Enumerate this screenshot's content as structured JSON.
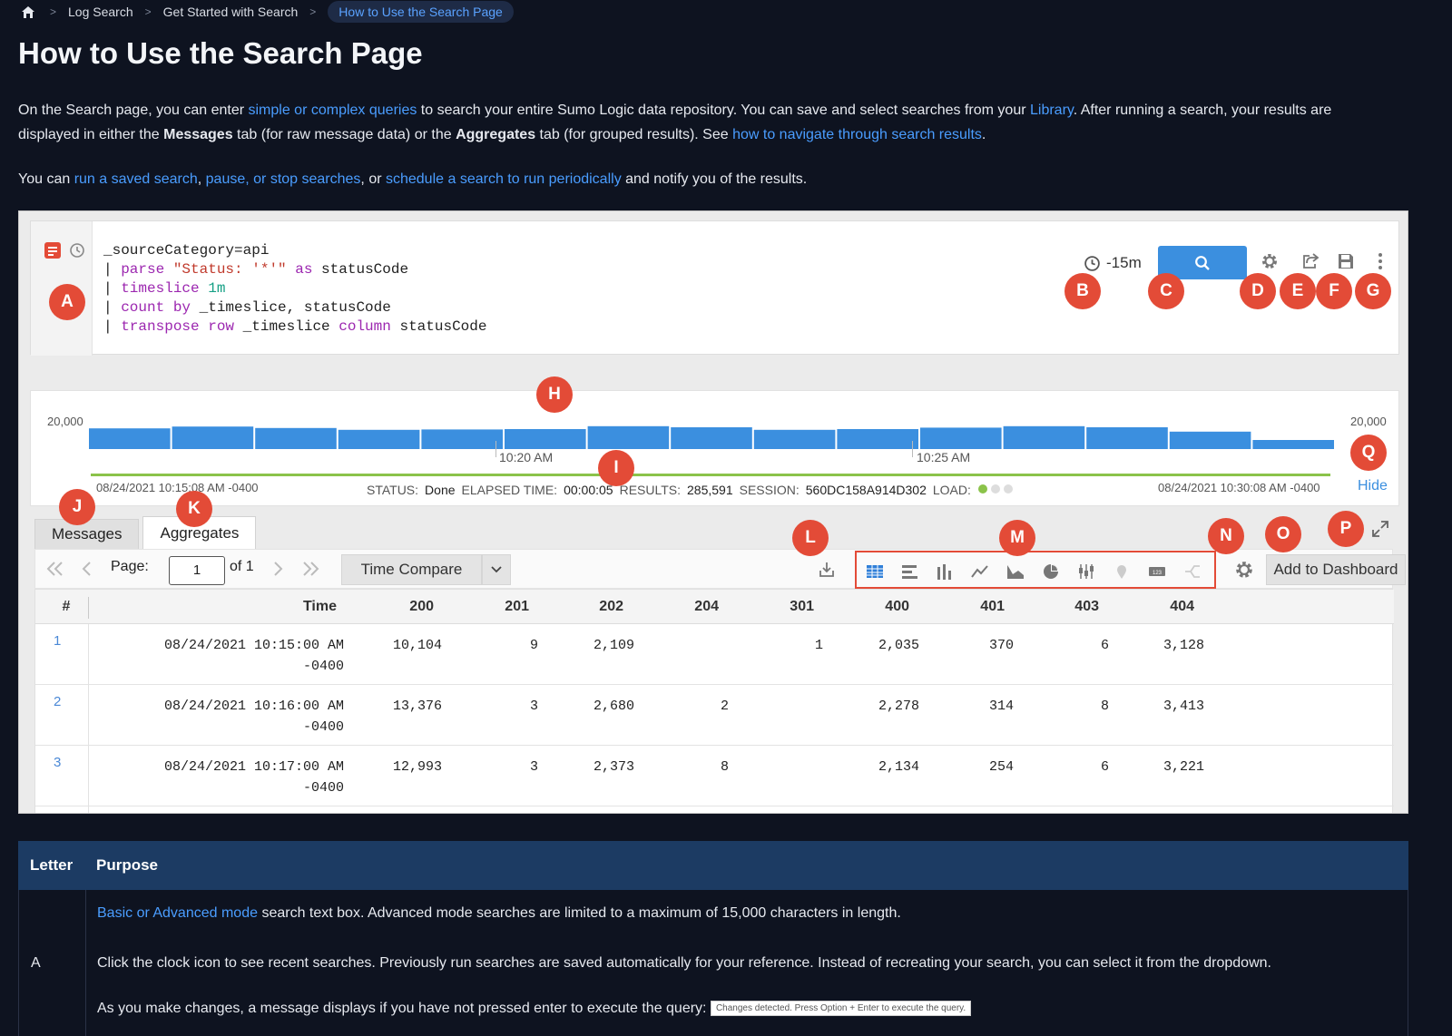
{
  "breadcrumb": {
    "items": [
      "Log Search",
      "Get Started with Search"
    ],
    "current": "How to Use the Search Page"
  },
  "title": "How to Use the Search Page",
  "intro": {
    "p1": {
      "t1": "On the Search page, you can enter ",
      "l1": "simple or complex queries",
      "t2": " to search your entire Sumo Logic data repository. You can save and select searches from your ",
      "l2": "Library",
      "t3": ". After running a search, your results are displayed in either the ",
      "b1": "Messages",
      "t4": " tab (for raw message data) or the ",
      "b2": "Aggregates",
      "t5": " tab (for grouped results). See ",
      "l3": "how to navigate through search results",
      "t6": "."
    },
    "p2": {
      "t1": "You can ",
      "l1": "run a saved search",
      "t2": ", ",
      "l2": "pause, or stop searches",
      "t3": ", or ",
      "l3": "schedule a search to run periodically",
      "t4": " and notify you of the results."
    }
  },
  "screenshot": {
    "query": {
      "l1": "_sourceCategory=api",
      "l2a": "| ",
      "l2b": "parse",
      "l2c": " \"Status: '*'\"",
      "l2d": " as",
      "l2e": " statusCode",
      "l3a": "| ",
      "l3b": "timeslice",
      "l3c": " 1m",
      "l4a": "| ",
      "l4b": "count by",
      "l4c": " _timeslice, statusCode",
      "l5a": "| ",
      "l5b": "transpose row",
      "l5c": " _timeslice ",
      "l5d": "column",
      "l5e": " statusCode"
    },
    "time_range": "-15m",
    "histogram": {
      "y_label_left": "20,000",
      "y_label_right": "20,000",
      "x_ticks": [
        "10:20 AM",
        "10:25 AM"
      ],
      "start": "08/24/2021 10:15:08 AM -0400",
      "end": "08/24/2021 10:30:08 AM -0400",
      "hide": "Hide",
      "bars": [
        0.57,
        0.62,
        0.58,
        0.53,
        0.54,
        0.55,
        0.63,
        0.6,
        0.53,
        0.55,
        0.59,
        0.63,
        0.6,
        0.48,
        0.25
      ]
    },
    "status": {
      "status_label": "STATUS:",
      "status": "Done",
      "elapsed_label": "ELAPSED TIME:",
      "elapsed": "00:00:05",
      "results_label": "RESULTS:",
      "results": "285,591",
      "session_label": "SESSION:",
      "session": "560DC158A914D302",
      "load_label": "LOAD:"
    },
    "tabs": [
      "Messages",
      "Aggregates"
    ],
    "pager": {
      "page_label": "Page:",
      "page": "1",
      "of": "of 1"
    },
    "time_compare": "Time Compare",
    "add_to_dashboard": "Add to Dashboard",
    "columns": [
      "#",
      "Time",
      "200",
      "201",
      "202",
      "204",
      "301",
      "400",
      "401",
      "403",
      "404"
    ],
    "rows": [
      {
        "n": "1",
        "time1": "08/24/2021 10:15:00 AM",
        "time2": "-0400",
        "c200": "10,104",
        "c201": "9",
        "c202": "2,109",
        "c204": "",
        "c301": "1",
        "c400": "2,035",
        "c401": "370",
        "c403": "6",
        "c404": "3,128"
      },
      {
        "n": "2",
        "time1": "08/24/2021 10:16:00 AM",
        "time2": "-0400",
        "c200": "13,376",
        "c201": "3",
        "c202": "2,680",
        "c204": "2",
        "c301": "",
        "c400": "2,278",
        "c401": "314",
        "c403": "8",
        "c404": "3,413"
      },
      {
        "n": "3",
        "time1": "08/24/2021 10:17:00 AM",
        "time2": "-0400",
        "c200": "12,993",
        "c201": "3",
        "c202": "2,373",
        "c204": "8",
        "c301": "",
        "c400": "2,134",
        "c401": "254",
        "c403": "6",
        "c404": "3,221"
      }
    ],
    "markers": [
      "A",
      "B",
      "C",
      "D",
      "E",
      "F",
      "G",
      "H",
      "I",
      "J",
      "K",
      "L",
      "M",
      "N",
      "O",
      "P",
      "Q"
    ]
  },
  "legend_table": {
    "headers": [
      "Letter",
      "Purpose"
    ],
    "row_letter": "A",
    "lines": {
      "l1_link": "Basic or Advanced mode",
      "l1_text": " search text box. Advanced mode searches are limited to a maximum of 15,000 characters in length.",
      "l2": "Click the clock icon to see recent searches. Previously run searches are saved automatically for your reference. Instead of recreating your search, you can select it from the dropdown.",
      "l3": "As you make changes, a message displays if you have not pressed enter to execute the query:",
      "chip": "Changes detected. Press Option + Enter to execute the query."
    }
  },
  "colors": {
    "page_bg": "#0e1320",
    "link": "#4a9dff",
    "marker": "#e34b37",
    "bar": "#3b8fdf",
    "table_header": "#1c3b63"
  }
}
